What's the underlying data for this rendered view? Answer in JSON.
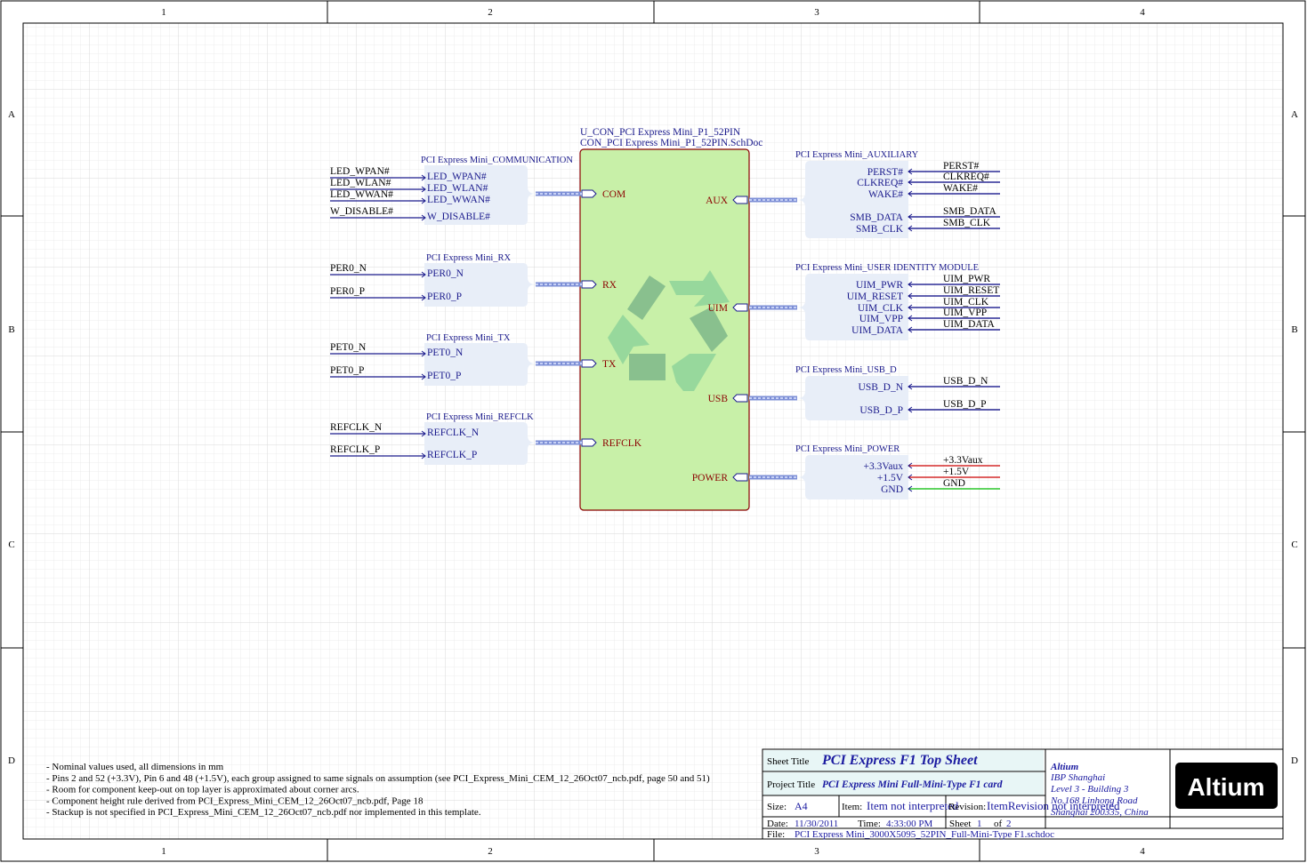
{
  "border": {
    "columns": [
      "1",
      "2",
      "3",
      "4"
    ],
    "rows": [
      "A",
      "B",
      "C",
      "D"
    ]
  },
  "main_sheet": {
    "designator": "U_CON_PCI Express Mini_P1_52PIN",
    "filename": "CON_PCI Express Mini_P1_52PIN.SchDoc",
    "left_ports": [
      "COM",
      "RX",
      "TX",
      "REFCLK"
    ],
    "right_ports": [
      "AUX",
      "UIM",
      "USB",
      "POWER"
    ]
  },
  "left_harnesses": [
    {
      "title": "PCI Express Mini_COMMUNICATION",
      "entries": [
        "LED_WPAN#",
        "LED_WLAN#",
        "LED_WWAN#",
        "W_DISABLE#"
      ],
      "nets": [
        "LED_WPAN#",
        "LED_WLAN#",
        "LED_WWAN#",
        "W_DISABLE#"
      ]
    },
    {
      "title": "PCI Express Mini_RX",
      "entries": [
        "PER0_N",
        "PER0_P"
      ],
      "nets": [
        "PER0_N",
        "PER0_P"
      ]
    },
    {
      "title": "PCI Express Mini_TX",
      "entries": [
        "PET0_N",
        "PET0_P"
      ],
      "nets": [
        "PET0_N",
        "PET0_P"
      ]
    },
    {
      "title": "PCI Express Mini_REFCLK",
      "entries": [
        "REFCLK_N",
        "REFCLK_P"
      ],
      "nets": [
        "REFCLK_N",
        "REFCLK_P"
      ]
    }
  ],
  "right_harnesses": [
    {
      "title": "PCI Express Mini_AUXILIARY",
      "entries": [
        "PERST#",
        "CLKREQ#",
        "WAKE#",
        "SMB_DATA",
        "SMB_CLK"
      ],
      "nets": [
        "PERST#",
        "CLKREQ#",
        "WAKE#",
        "SMB_DATA",
        "SMB_CLK"
      ]
    },
    {
      "title": "PCI Express Mini_USER IDENTITY MODULE",
      "entries": [
        "UIM_PWR",
        "UIM_RESET",
        "UIM_CLK",
        "UIM_VPP",
        "UIM_DATA"
      ],
      "nets": [
        "UIM_PWR",
        "UIM_RESET",
        "UIM_CLK",
        "UIM_VPP",
        "UIM_DATA"
      ]
    },
    {
      "title": "PCI Express Mini_USB_D",
      "entries": [
        "USB_D_N",
        "USB_D_P"
      ],
      "nets": [
        "USB_D_N",
        "USB_D_P"
      ]
    },
    {
      "title": "PCI Express Mini_POWER",
      "entries": [
        "+3.3Vaux",
        "+1.5V",
        "GND"
      ],
      "nets": [
        "+3.3Vaux",
        "+1.5V",
        "GND"
      ]
    }
  ],
  "net_colors": {
    "+3.3Vaux": "#cc0000",
    "+1.5V": "#cc0000",
    "GND": "#00bb00",
    "default": "#000080"
  },
  "notes": [
    "- Nominal values used, all dimensions in mm",
    "- Pins 2 and 52 (+3.3V), Pin 6 and 48 (+1.5V), each group assigned to same signals on assumption (see PCI_Express_Mini_CEM_12_26Oct07_ncb.pdf, page 50 and 51)",
    "- Room for component keep-out on top layer is approximated about corner arcs.",
    "- Component height rule derived from PCI_Express_Mini_CEM_12_26Oct07_ncb.pdf, Page 18",
    "- Stackup is not specified in PCI_Express_Mini_CEM_12_26Oct07_ncb.pdf nor implemented in this template."
  ],
  "title_block": {
    "sheet_title_label": "Sheet Title",
    "sheet_title": "PCI Express F1 Top Sheet",
    "project_title_label": "Project Title",
    "project_title": "PCI Express Mini Full-Mini-Type F1 card",
    "size_label": "Size:",
    "size": "A4",
    "item_label": "Item:",
    "item": "Item not interpreted",
    "revision_label": "Revision:",
    "revision": "ItemRevision not interpreted",
    "date_label": "Date:",
    "date": "11/30/2011",
    "time_label": "Time:",
    "time": "4:33:00 PM",
    "sheet_label": "Sheet",
    "sheet_num": "1",
    "of_label": "of",
    "sheet_total": "2",
    "file_label": "File:",
    "file": "PCI Express Mini_3000X5095_52PIN_Full-Mini-Type F1.schdoc",
    "company": "Altium",
    "address": [
      "IBP Shanghai",
      "Level 3 - Building 3",
      "No.168 Linhong Road",
      "Shanghai 200335, China"
    ],
    "logo_text": "Altium"
  },
  "accent_colors": {
    "sheet_fill": "#c8f0a8",
    "harness_fill": "#e8eef8",
    "wire_blue": "#1a1a8c",
    "bus": "#8a9ad8"
  }
}
